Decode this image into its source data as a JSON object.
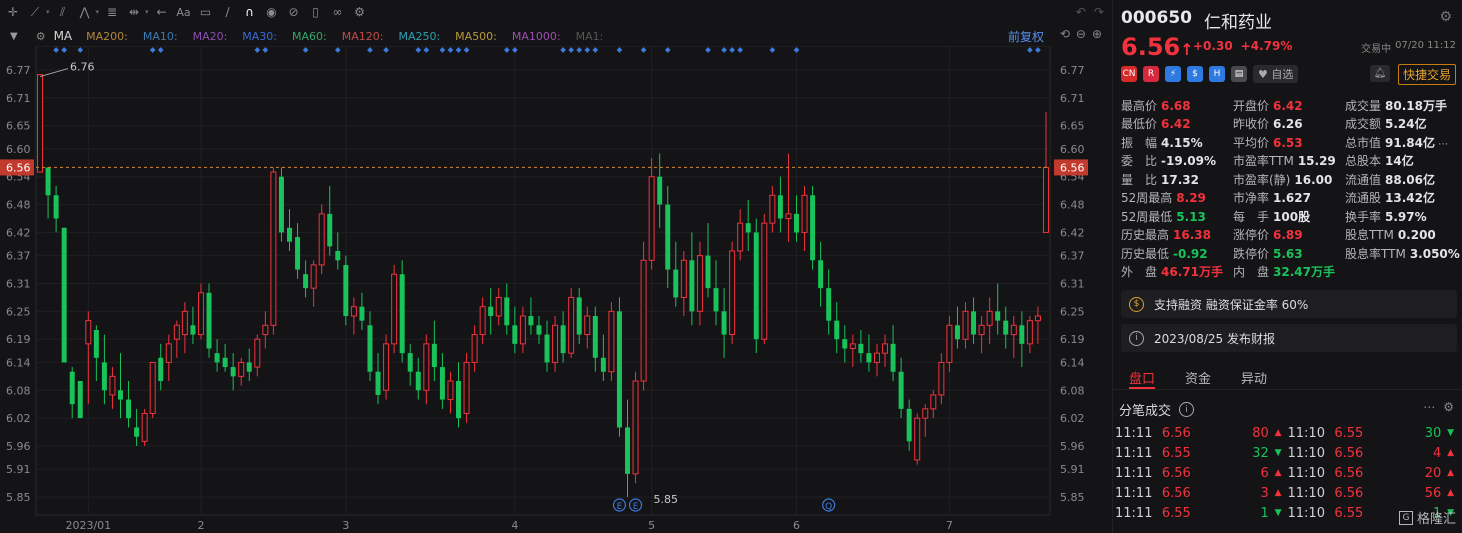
{
  "toolbar": {
    "icons": [
      "crosshair-icon",
      "line-tool-icon",
      "channel-tool-icon",
      "pattern-tool-icon",
      "fib-tool-icon",
      "range-tool-icon",
      "arrow-tool-icon",
      "text-tool-icon",
      "note-tool-icon",
      "brush-tool-icon",
      "magnet-icon",
      "eye-icon",
      "hide-icon",
      "trash-icon",
      "link-icon",
      "settings-icon"
    ]
  },
  "indicator": {
    "name": "MA",
    "ma_items": [
      {
        "label": "MA200:",
        "color": "#b5863b"
      },
      {
        "label": "MA10:",
        "color": "#3a7ab0"
      },
      {
        "label": "MA20:",
        "color": "#8a4fb0"
      },
      {
        "label": "MA30:",
        "color": "#3a6ad0"
      },
      {
        "label": "MA60:",
        "color": "#34a56a"
      },
      {
        "label": "MA120:",
        "color": "#c04a4a"
      },
      {
        "label": "MA250:",
        "color": "#2f9fb0"
      },
      {
        "label": "MA500:",
        "color": "#b59a3b"
      },
      {
        "label": "MA1000:",
        "color": "#9a4fb0"
      },
      {
        "label": "MA1:",
        "color": "#555"
      }
    ],
    "fuquan": "前复权"
  },
  "chart_data": {
    "type": "candlestick",
    "y_ticks": [
      "6.77",
      "6.71",
      "6.65",
      "6.60",
      "6.54",
      "6.48",
      "6.42",
      "6.37",
      "6.31",
      "6.25",
      "6.19",
      "6.14",
      "6.08",
      "6.02",
      "5.96",
      "5.91",
      "5.85"
    ],
    "ylim": [
      5.82,
      6.8
    ],
    "x_ticks": [
      {
        "label": "2023/01",
        "i": 6
      },
      {
        "label": "2",
        "i": 20
      },
      {
        "label": "3",
        "i": 38
      },
      {
        "label": "4",
        "i": 59
      },
      {
        "label": "5",
        "i": 76
      },
      {
        "label": "6",
        "i": 94
      },
      {
        "label": "7",
        "i": 113
      }
    ],
    "current_price": "6.56",
    "current_price_value": 6.56,
    "max_label": {
      "text": "6.76",
      "i": 0,
      "value": 6.76
    },
    "min_label": {
      "text": "5.85",
      "i": 73,
      "value": 5.85
    },
    "event_markers": [
      {
        "text": "E",
        "i": 72
      },
      {
        "text": "E",
        "i": 74
      },
      {
        "text": "Q",
        "i": 98
      }
    ],
    "dot_marker_indices": [
      2,
      3,
      5,
      14,
      15,
      27,
      28,
      33,
      37,
      41,
      43,
      47,
      48,
      50,
      51,
      52,
      53,
      58,
      59,
      65,
      66,
      67,
      68,
      69,
      72,
      75,
      78,
      83,
      85,
      86,
      87,
      91,
      94,
      123,
      124
    ],
    "candles": [
      [
        6.55,
        6.76,
        6.55,
        6.76
      ],
      [
        6.56,
        6.56,
        6.45,
        6.5
      ],
      [
        6.5,
        6.52,
        6.42,
        6.45
      ],
      [
        6.43,
        6.43,
        6.14,
        6.14
      ],
      [
        6.12,
        6.13,
        6.02,
        6.05
      ],
      [
        6.1,
        6.1,
        6.02,
        6.02
      ],
      [
        6.18,
        6.25,
        6.05,
        6.23
      ],
      [
        6.21,
        6.22,
        6.1,
        6.15
      ],
      [
        6.14,
        6.2,
        6.05,
        6.08
      ],
      [
        6.07,
        6.13,
        6.04,
        6.11
      ],
      [
        6.08,
        6.16,
        6.02,
        6.06
      ],
      [
        6.06,
        6.1,
        6.0,
        6.02
      ],
      [
        6.0,
        6.04,
        5.96,
        5.98
      ],
      [
        5.97,
        6.04,
        5.96,
        6.03
      ],
      [
        6.03,
        6.14,
        6.02,
        6.14
      ],
      [
        6.15,
        6.18,
        6.08,
        6.1
      ],
      [
        6.14,
        6.2,
        6.1,
        6.18
      ],
      [
        6.19,
        6.23,
        6.15,
        6.22
      ],
      [
        6.2,
        6.27,
        6.16,
        6.25
      ],
      [
        6.22,
        6.26,
        6.18,
        6.2
      ],
      [
        6.2,
        6.31,
        6.19,
        6.29
      ],
      [
        6.29,
        6.31,
        6.15,
        6.17
      ],
      [
        6.16,
        6.19,
        6.12,
        6.14
      ],
      [
        6.15,
        6.18,
        6.12,
        6.13
      ],
      [
        6.13,
        6.16,
        6.08,
        6.11
      ],
      [
        6.11,
        6.15,
        6.09,
        6.14
      ],
      [
        6.14,
        6.17,
        6.1,
        6.12
      ],
      [
        6.13,
        6.2,
        6.11,
        6.19
      ],
      [
        6.2,
        6.25,
        6.17,
        6.22
      ],
      [
        6.22,
        6.56,
        6.2,
        6.55
      ],
      [
        6.54,
        6.56,
        6.4,
        6.42
      ],
      [
        6.43,
        6.47,
        6.38,
        6.4
      ],
      [
        6.41,
        6.44,
        6.32,
        6.34
      ],
      [
        6.33,
        6.36,
        6.28,
        6.3
      ],
      [
        6.3,
        6.36,
        6.26,
        6.35
      ],
      [
        6.35,
        6.48,
        6.33,
        6.46
      ],
      [
        6.46,
        6.52,
        6.37,
        6.39
      ],
      [
        6.38,
        6.42,
        6.34,
        6.36
      ],
      [
        6.35,
        6.37,
        6.22,
        6.24
      ],
      [
        6.24,
        6.28,
        6.2,
        6.26
      ],
      [
        6.26,
        6.29,
        6.21,
        6.23
      ],
      [
        6.22,
        6.25,
        6.1,
        6.12
      ],
      [
        6.12,
        6.16,
        6.05,
        6.07
      ],
      [
        6.08,
        6.2,
        6.06,
        6.18
      ],
      [
        6.18,
        6.35,
        6.16,
        6.33
      ],
      [
        6.33,
        6.36,
        6.14,
        6.16
      ],
      [
        6.16,
        6.18,
        6.09,
        6.12
      ],
      [
        6.12,
        6.15,
        6.06,
        6.08
      ],
      [
        6.08,
        6.2,
        6.05,
        6.18
      ],
      [
        6.18,
        6.23,
        6.1,
        6.13
      ],
      [
        6.13,
        6.16,
        6.04,
        6.06
      ],
      [
        6.06,
        6.12,
        6.03,
        6.1
      ],
      [
        6.1,
        6.14,
        6.0,
        6.02
      ],
      [
        6.03,
        6.16,
        6.01,
        6.14
      ],
      [
        6.14,
        6.22,
        6.12,
        6.2
      ],
      [
        6.2,
        6.28,
        6.18,
        6.26
      ],
      [
        6.26,
        6.3,
        6.2,
        6.24
      ],
      [
        6.24,
        6.3,
        6.22,
        6.28
      ],
      [
        6.28,
        6.31,
        6.2,
        6.22
      ],
      [
        6.22,
        6.26,
        6.16,
        6.18
      ],
      [
        6.18,
        6.26,
        6.16,
        6.24
      ],
      [
        6.24,
        6.28,
        6.2,
        6.22
      ],
      [
        6.22,
        6.24,
        6.18,
        6.2
      ],
      [
        6.2,
        6.23,
        6.12,
        6.14
      ],
      [
        6.14,
        6.24,
        6.12,
        6.22
      ],
      [
        6.22,
        6.25,
        6.14,
        6.16
      ],
      [
        6.16,
        6.3,
        6.15,
        6.28
      ],
      [
        6.28,
        6.3,
        6.18,
        6.2
      ],
      [
        6.2,
        6.26,
        6.17,
        6.24
      ],
      [
        6.24,
        6.26,
        6.12,
        6.15
      ],
      [
        6.15,
        6.2,
        6.1,
        6.12
      ],
      [
        6.12,
        6.27,
        6.1,
        6.25
      ],
      [
        6.25,
        6.28,
        5.98,
        6.0
      ],
      [
        6.0,
        6.06,
        5.85,
        5.9
      ],
      [
        5.9,
        6.12,
        5.88,
        6.1
      ],
      [
        6.1,
        6.4,
        6.08,
        6.36
      ],
      [
        6.36,
        6.58,
        6.34,
        6.54
      ],
      [
        6.54,
        6.59,
        6.43,
        6.48
      ],
      [
        6.48,
        6.52,
        6.3,
        6.34
      ],
      [
        6.34,
        6.4,
        6.26,
        6.28
      ],
      [
        6.28,
        6.38,
        6.24,
        6.36
      ],
      [
        6.36,
        6.42,
        6.22,
        6.25
      ],
      [
        6.25,
        6.4,
        6.22,
        6.37
      ],
      [
        6.37,
        6.44,
        6.28,
        6.3
      ],
      [
        6.3,
        6.36,
        6.22,
        6.25
      ],
      [
        6.25,
        6.3,
        6.15,
        6.2
      ],
      [
        6.2,
        6.4,
        6.18,
        6.38
      ],
      [
        6.38,
        6.47,
        6.36,
        6.44
      ],
      [
        6.44,
        6.49,
        6.38,
        6.42
      ],
      [
        6.42,
        6.45,
        6.16,
        6.19
      ],
      [
        6.19,
        6.46,
        6.18,
        6.44
      ],
      [
        6.44,
        6.52,
        6.42,
        6.5
      ],
      [
        6.5,
        6.54,
        6.42,
        6.45
      ],
      [
        6.45,
        6.59,
        6.4,
        6.46
      ],
      [
        6.46,
        6.5,
        6.4,
        6.42
      ],
      [
        6.42,
        6.52,
        6.38,
        6.5
      ],
      [
        6.5,
        6.52,
        6.34,
        6.36
      ],
      [
        6.36,
        6.4,
        6.26,
        6.3
      ],
      [
        6.3,
        6.34,
        6.2,
        6.23
      ],
      [
        6.23,
        6.27,
        6.16,
        6.19
      ],
      [
        6.19,
        6.22,
        6.14,
        6.17
      ],
      [
        6.17,
        6.2,
        6.13,
        6.18
      ],
      [
        6.18,
        6.21,
        6.14,
        6.16
      ],
      [
        6.16,
        6.2,
        6.12,
        6.14
      ],
      [
        6.14,
        6.18,
        6.11,
        6.16
      ],
      [
        6.16,
        6.2,
        6.13,
        6.18
      ],
      [
        6.18,
        6.22,
        6.1,
        6.12
      ],
      [
        6.12,
        6.15,
        6.02,
        6.04
      ],
      [
        6.04,
        6.06,
        5.95,
        5.97
      ],
      [
        5.93,
        6.03,
        5.92,
        6.02
      ],
      [
        6.02,
        6.05,
        5.98,
        6.04
      ],
      [
        6.04,
        6.08,
        6.02,
        6.07
      ],
      [
        6.07,
        6.16,
        6.05,
        6.14
      ],
      [
        6.14,
        6.24,
        6.12,
        6.22
      ],
      [
        6.22,
        6.26,
        6.17,
        6.19
      ],
      [
        6.19,
        6.27,
        6.17,
        6.25
      ],
      [
        6.25,
        6.28,
        6.18,
        6.2
      ],
      [
        6.2,
        6.24,
        6.16,
        6.22
      ],
      [
        6.22,
        6.28,
        6.18,
        6.25
      ],
      [
        6.25,
        6.31,
        6.2,
        6.23
      ],
      [
        6.23,
        6.26,
        6.17,
        6.2
      ],
      [
        6.2,
        6.24,
        6.15,
        6.22
      ],
      [
        6.22,
        6.25,
        6.13,
        6.18
      ],
      [
        6.18,
        6.24,
        6.16,
        6.23
      ],
      [
        6.23,
        6.26,
        6.18,
        6.24
      ],
      [
        6.42,
        6.68,
        6.42,
        6.56
      ]
    ]
  },
  "quote": {
    "code": "000650",
    "name": "仁和药业",
    "price": "6.56",
    "arrow": "↑",
    "change": "+0.30",
    "change_pct": "+4.79%",
    "status": "交易中",
    "time": "07/20 11:12",
    "badges": [
      "CN",
      "R",
      "⚡",
      "$",
      "H",
      "▤"
    ],
    "watch_label": "自选",
    "quick_trade": "快捷交易"
  },
  "stats": [
    [
      {
        "k": "最高价",
        "v": "6.68",
        "c": "red"
      },
      {
        "k": "开盘价",
        "v": "6.42",
        "c": "red"
      },
      {
        "k": "成交量",
        "v": "80.18万手",
        "c": ""
      }
    ],
    [
      {
        "k": "最低价",
        "v": "6.42",
        "c": "red"
      },
      {
        "k": "昨收价",
        "v": "6.26",
        "c": ""
      },
      {
        "k": "成交额",
        "v": "5.24亿",
        "c": ""
      }
    ],
    [
      {
        "k": "振　幅",
        "v": "4.15%",
        "c": ""
      },
      {
        "k": "平均价",
        "v": "6.53",
        "c": "red"
      },
      {
        "k": "总市值",
        "v": "91.84亿",
        "c": ""
      }
    ],
    [
      {
        "k": "委　比",
        "v": "-19.09%",
        "c": ""
      },
      {
        "k": "市盈率TTM",
        "v": "15.29",
        "c": ""
      },
      {
        "k": "总股本",
        "v": "14亿",
        "c": ""
      }
    ],
    [
      {
        "k": "量　比",
        "v": "17.32",
        "c": ""
      },
      {
        "k": "市盈率(静)",
        "v": "16.00",
        "c": ""
      },
      {
        "k": "流通值",
        "v": "88.06亿",
        "c": ""
      }
    ],
    [
      {
        "k": "52周最高",
        "v": "8.29",
        "c": "red"
      },
      {
        "k": "市净率",
        "v": "1.627",
        "c": ""
      },
      {
        "k": "流通股",
        "v": "13.42亿",
        "c": ""
      }
    ],
    [
      {
        "k": "52周最低",
        "v": "5.13",
        "c": "green"
      },
      {
        "k": "每　手",
        "v": "100股",
        "c": ""
      },
      {
        "k": "换手率",
        "v": "5.97%",
        "c": ""
      }
    ],
    [
      {
        "k": "历史最高",
        "v": "16.38",
        "c": "red"
      },
      {
        "k": "涨停价",
        "v": "6.89",
        "c": "red"
      },
      {
        "k": "股息TTM",
        "v": "0.200",
        "c": ""
      }
    ],
    [
      {
        "k": "历史最低",
        "v": "-0.92",
        "c": "green"
      },
      {
        "k": "跌停价",
        "v": "5.63",
        "c": "green"
      },
      {
        "k": "股息率TTM",
        "v": "3.050%",
        "c": ""
      }
    ],
    [
      {
        "k": "外　盘",
        "v": "46.71万手",
        "c": "red"
      },
      {
        "k": "内　盘",
        "v": "32.47万手",
        "c": "green"
      },
      {
        "k": "",
        "v": "",
        "c": ""
      }
    ]
  ],
  "notices": [
    {
      "icon": "$",
      "text": "支持融资 融资保证金率 60%"
    },
    {
      "icon": "i",
      "text": "2023/08/25  发布财报"
    }
  ],
  "tabs": [
    "盘口",
    "资金",
    "异动"
  ],
  "trades_title": "分笔成交",
  "trades": [
    [
      {
        "t": "11:11",
        "p": "6.56",
        "pc": "red",
        "v": "80",
        "vc": "red",
        "a": "▲"
      },
      {
        "t": "11:10",
        "p": "6.55",
        "pc": "red",
        "v": "30",
        "vc": "green",
        "a": "▼"
      }
    ],
    [
      {
        "t": "11:11",
        "p": "6.55",
        "pc": "red",
        "v": "32",
        "vc": "green",
        "a": "▼"
      },
      {
        "t": "11:10",
        "p": "6.56",
        "pc": "red",
        "v": "4",
        "vc": "red",
        "a": "▲"
      }
    ],
    [
      {
        "t": "11:11",
        "p": "6.56",
        "pc": "red",
        "v": "6",
        "vc": "red",
        "a": "▲"
      },
      {
        "t": "11:10",
        "p": "6.56",
        "pc": "red",
        "v": "20",
        "vc": "red",
        "a": "▲"
      }
    ],
    [
      {
        "t": "11:11",
        "p": "6.56",
        "pc": "red",
        "v": "3",
        "vc": "red",
        "a": "▲"
      },
      {
        "t": "11:10",
        "p": "6.56",
        "pc": "red",
        "v": "56",
        "vc": "red",
        "a": "▲"
      }
    ],
    [
      {
        "t": "11:11",
        "p": "6.55",
        "pc": "red",
        "v": "1",
        "vc": "green",
        "a": "▼"
      },
      {
        "t": "11:10",
        "p": "6.55",
        "pc": "red",
        "v": "1",
        "vc": "green",
        "a": "▼"
      }
    ]
  ],
  "watermark": "格隆汇",
  "colors": {
    "up": "#f2323c",
    "down": "#19c25a",
    "dash": "#d8812b",
    "marker": "#3b7be0"
  }
}
